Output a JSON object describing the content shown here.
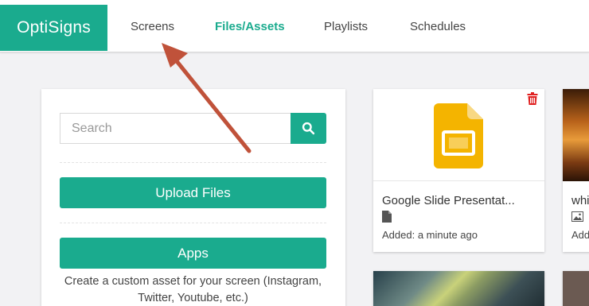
{
  "brand": "OptiSigns",
  "nav": [
    {
      "label": "Screens"
    },
    {
      "label": "Files/Assets"
    },
    {
      "label": "Playlists"
    },
    {
      "label": "Schedules"
    }
  ],
  "sidebar": {
    "search_placeholder": "Search",
    "upload_label": "Upload Files",
    "apps_label": "Apps",
    "apps_description": "Create a custom asset for your screen (Instagram, Twitter, Youtube, etc.)"
  },
  "assets": [
    {
      "title": "Google Slide Presentat...",
      "type_icon": "file-icon",
      "added": "Added: a minute ago"
    },
    {
      "title": "whi",
      "type_icon": "image-icon",
      "added": "Add"
    }
  ],
  "colors": {
    "accent": "#1aab8e",
    "arrow": "#c0523a",
    "danger": "#e02020",
    "slides_yellow": "#f4b400"
  }
}
